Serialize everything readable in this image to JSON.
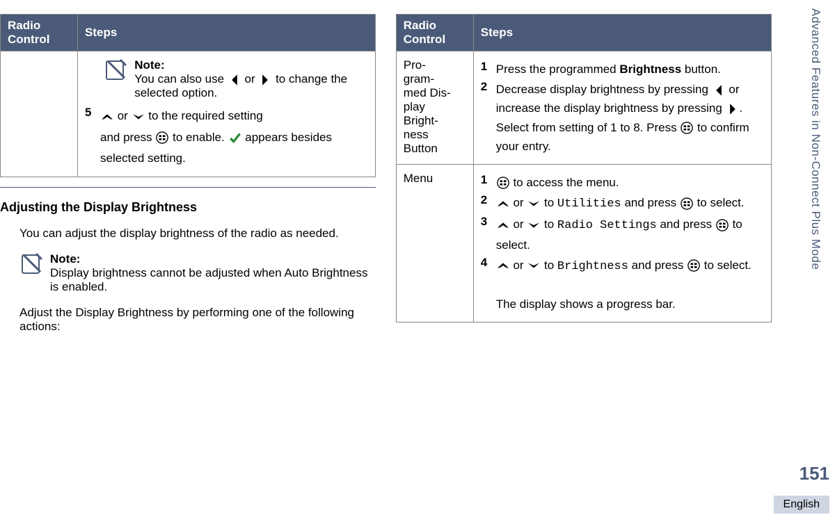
{
  "headers": {
    "radio_control": "Radio Control",
    "steps": "Steps"
  },
  "table1": {
    "note_label": "Note:",
    "note_text": "You can also use  or  to change the selected option.",
    "step_num": "5",
    "step_a": " or  to the required setting",
    "step_b": "and press  to enable.  appears besides selected setting."
  },
  "section_title": "Adjusting the Display Brightness",
  "intro": "You can adjust the display brightness of the radio as needed.",
  "note2_label": "Note:",
  "note2_text": "Display brightness cannot be adjusted when Auto Brightness is enabled.",
  "instr": "Adjust the Display Brightness by performing one of the following actions:",
  "table2": {
    "row1_label": "Pro-\ngram-\nmed Dis-\nplay\nBright-\nness\nButton",
    "row1_s1_n": "1",
    "row1_s1": "Press the programmed Brightness button.",
    "row1_s2_n": "2",
    "row1_s2_a": "Decrease display brightness by",
    "row1_s2_b": "pressing  or increase the display",
    "row1_s2_c": "brightness by pressing . Select",
    "row1_s2_d": "from setting of 1 to 8. Press  to confirm your entry.",
    "row2_label": "Menu",
    "row2_s1_n": "1",
    "row2_s1": " to access the menu.",
    "row2_s2_n": "2",
    "row2_s2_a": " or  to ",
    "row2_s2_b": "Utilities",
    "row2_s2_c": " and press",
    "row2_s2_d": " to select.",
    "row2_s3_n": "3",
    "row2_s3_a": " or  to ",
    "row2_s3_b": "Radio Settings",
    "row2_s3_c": " and",
    "row2_s3_d": "press  to select.",
    "row2_s4_n": "4",
    "row2_s4_a": " or  to ",
    "row2_s4_b": "Brightness",
    "row2_s4_c": " and",
    "row2_s4_d": "press  to select.",
    "row2_tail": "The display shows a progress bar."
  },
  "side": "Advanced Features in Non-Connect Plus Mode",
  "pagenum": "151",
  "lang": "English"
}
